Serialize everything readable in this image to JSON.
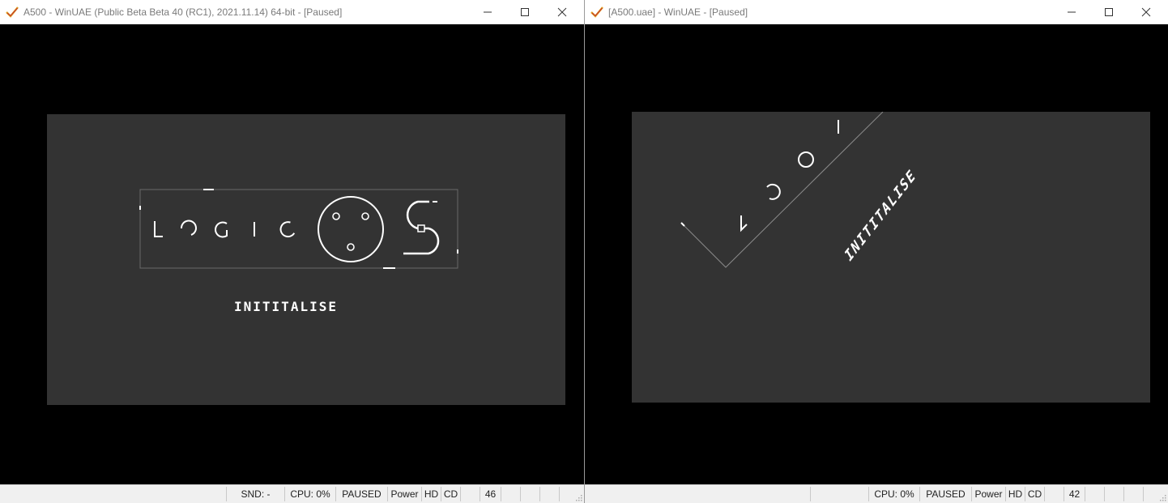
{
  "windows": [
    {
      "title": "A500 - WinUAE (Public Beta Beta 40 (RC1), 2021.11.14) 64-bit - [Paused]",
      "logo_text": "INITITALISE",
      "status": {
        "snd": "SND: -",
        "cpu": "CPU: 0%",
        "state": "PAUSED",
        "power": "Power",
        "hd": "HD",
        "cd": "CD",
        "df0": "46"
      }
    },
    {
      "title": "[A500.uae] - WinUAE - [Paused]",
      "logo_text": "INITITALISE",
      "status": {
        "cpu": "CPU: 0%",
        "state": "PAUSED",
        "power": "Power",
        "hd": "HD",
        "cd": "CD",
        "df0": "42"
      }
    }
  ],
  "icons": [
    "winuae-checkmark-icon",
    "minimize-icon",
    "maximize-icon",
    "close-icon",
    "resize-grip-icon"
  ],
  "colors": {
    "titlebar": "#ffffff",
    "screen_border": "#000000",
    "amiga_background": "#333333",
    "amiga_foreground": "#ffffff",
    "statusbar": "#f0f0f0"
  }
}
